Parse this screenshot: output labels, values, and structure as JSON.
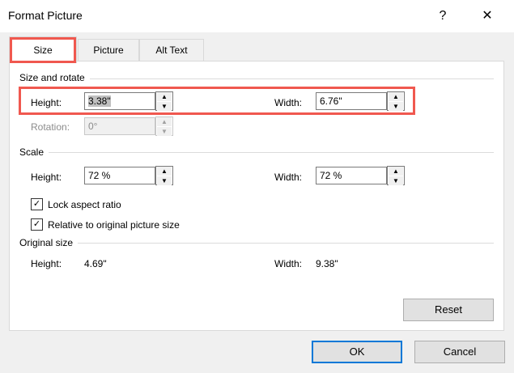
{
  "dialog": {
    "title": "Format Picture",
    "help_icon": "?",
    "close_icon": "✕"
  },
  "tabs": [
    {
      "label": "Size"
    },
    {
      "label": "Picture"
    },
    {
      "label": "Alt Text"
    }
  ],
  "size_rotate": {
    "header": "Size and rotate",
    "height_label": "Height:",
    "height_value": "3.38\"",
    "width_label": "Width:",
    "width_value": "6.76\"",
    "rotation_label": "Rotation:",
    "rotation_value": "0°"
  },
  "scale": {
    "header": "Scale",
    "height_label": "Height:",
    "height_value": "72 %",
    "width_label": "Width:",
    "width_value": "72 %",
    "lock_label": "Lock aspect ratio",
    "lock_checked": true,
    "relative_label": "Relative to original picture size",
    "relative_checked": true
  },
  "original": {
    "header": "Original size",
    "height_label": "Height:",
    "height_value": "4.69\"",
    "width_label": "Width:",
    "width_value": "9.38\""
  },
  "buttons": {
    "reset": "Reset",
    "ok": "OK",
    "cancel": "Cancel"
  },
  "highlight_color": "#f0584f"
}
